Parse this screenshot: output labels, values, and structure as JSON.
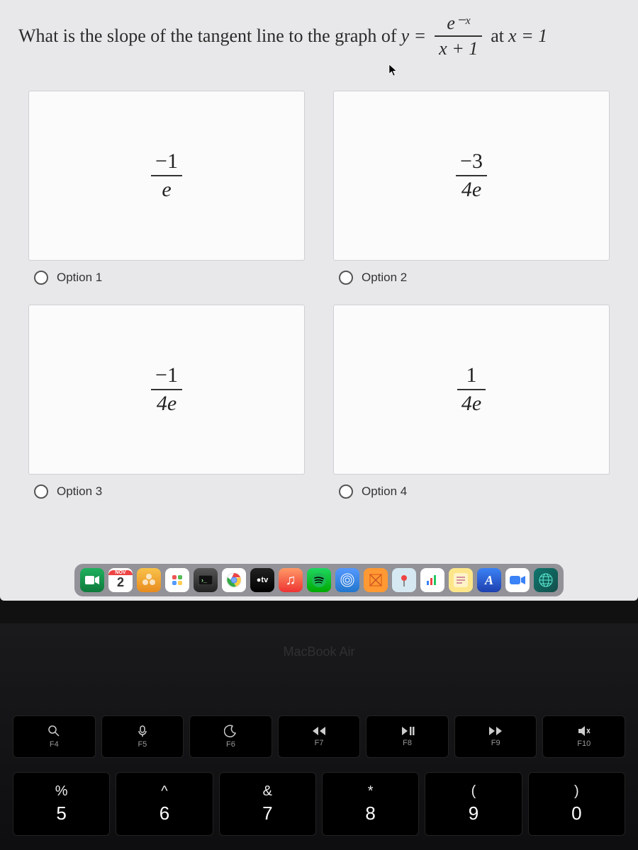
{
  "question": {
    "prefix": "What is the slope of the tangent line to the graph of",
    "y_eq": "y =",
    "frac_num": "e⁻ˣ",
    "frac_den": "x + 1",
    "at": "at",
    "xval": "x = 1"
  },
  "options": [
    {
      "num": "−1",
      "den": "e",
      "label": "Option 1"
    },
    {
      "num": "−3",
      "den": "4e",
      "label": "Option 2"
    },
    {
      "num": "−1",
      "den": "4e",
      "label": "Option 3"
    },
    {
      "num": "1",
      "den": "4e",
      "label": "Option 4"
    }
  ],
  "dock": {
    "calendar_month": "NOV",
    "calendar_day": "2",
    "tv_label": "●tv"
  },
  "keyboard": {
    "label": "MacBook Air",
    "fn": [
      {
        "label": "F4"
      },
      {
        "label": "F5"
      },
      {
        "label": "F6"
      },
      {
        "label": "F7"
      },
      {
        "label": "F8"
      },
      {
        "label": "F9"
      },
      {
        "label": "F10"
      }
    ],
    "num": [
      {
        "top": "%",
        "bot": "5"
      },
      {
        "top": "^",
        "bot": "6"
      },
      {
        "top": "&",
        "bot": "7"
      },
      {
        "top": "*",
        "bot": "8"
      },
      {
        "top": "(",
        "bot": "9"
      },
      {
        "top": ")",
        "bot": "0"
      }
    ]
  }
}
